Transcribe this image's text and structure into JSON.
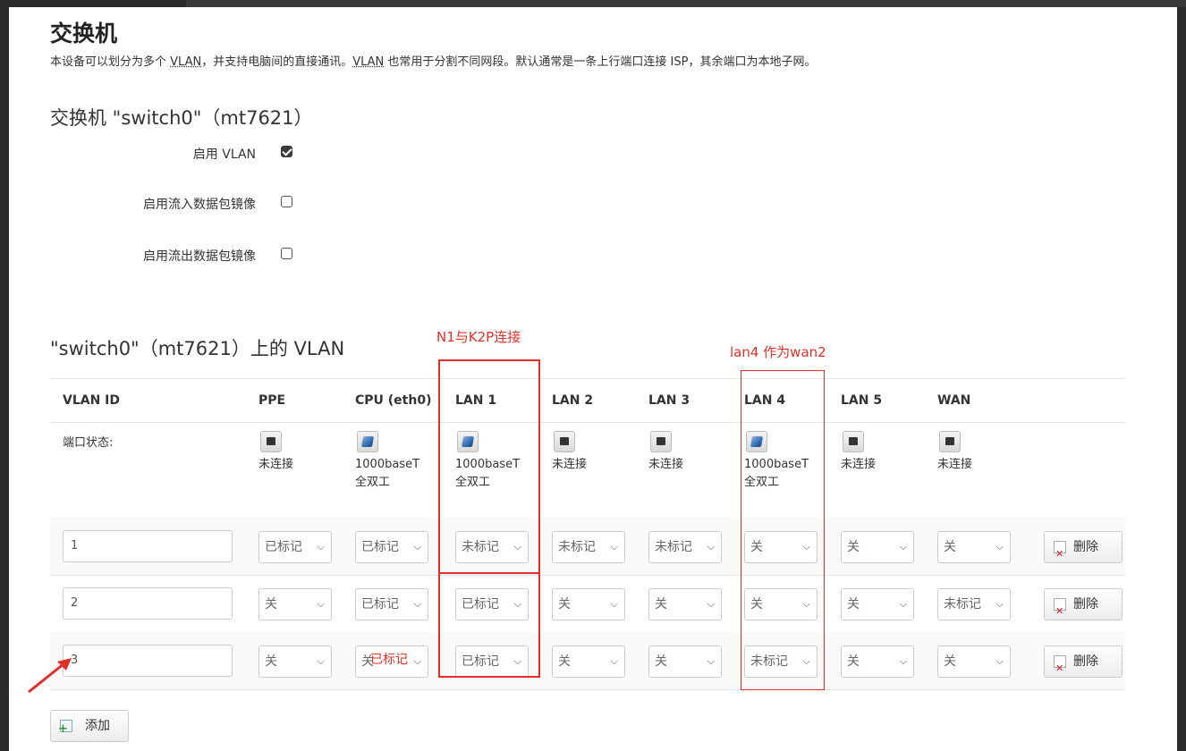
{
  "page": {
    "title": "交换机",
    "description_parts": [
      "本设备可以划分为多个 ",
      "VLAN",
      "，并支持电脑间的直接通讯。",
      "VLAN",
      " 也常用于分割不同网段。默认通常是一条上行端口连接 ISP，其余端口为本地子网。"
    ]
  },
  "switch_section": {
    "title": "交换机 \"switch0\"（mt7621）",
    "options": [
      {
        "label": "启用 VLAN",
        "checked": true
      },
      {
        "label": "启用流入数据包镜像",
        "checked": false
      },
      {
        "label": "启用流出数据包镜像",
        "checked": false
      }
    ]
  },
  "vlan_section": {
    "title": "\"switch0\"（mt7621）上的 VLAN",
    "headers": [
      "VLAN ID",
      "PPE",
      "CPU (eth0)",
      "LAN 1",
      "LAN 2",
      "LAN 3",
      "LAN 4",
      "LAN 5",
      "WAN"
    ],
    "status_label": "端口状态:",
    "port_status": [
      {
        "icon": "port-disconnected-icon",
        "line1": "未连接",
        "line2": ""
      },
      {
        "icon": "port-connected-icon",
        "line1": "1000baseT",
        "line2": "全双工"
      },
      {
        "icon": "port-connected-icon",
        "line1": "1000baseT",
        "line2": "全双工"
      },
      {
        "icon": "port-disconnected-icon",
        "line1": "未连接",
        "line2": ""
      },
      {
        "icon": "port-disconnected-icon",
        "line1": "未连接",
        "line2": ""
      },
      {
        "icon": "port-connected-icon",
        "line1": "1000baseT",
        "line2": "全双工"
      },
      {
        "icon": "port-disconnected-icon",
        "line1": "未连接",
        "line2": ""
      },
      {
        "icon": "port-disconnected-icon",
        "line1": "未连接",
        "line2": ""
      }
    ],
    "rows": [
      {
        "vlan_id": "1",
        "ports": [
          "已标记",
          "已标记",
          "未标记",
          "未标记",
          "未标记",
          "关",
          "关",
          "关"
        ]
      },
      {
        "vlan_id": "2",
        "ports": [
          "关",
          "已标记",
          "已标记",
          "关",
          "关",
          "关",
          "关",
          "未标记"
        ]
      },
      {
        "vlan_id": "3",
        "ports": [
          "关",
          "关",
          "已标记",
          "关",
          "关",
          "未标记",
          "关",
          "关"
        ]
      }
    ],
    "delete_label": "删除",
    "add_label": "添加"
  },
  "annotations": {
    "lan1_note": "N1与K2P连接",
    "lan4_note": "lan4 作为wan2",
    "cpu_note": "已标记",
    "color": "#e0302a"
  }
}
